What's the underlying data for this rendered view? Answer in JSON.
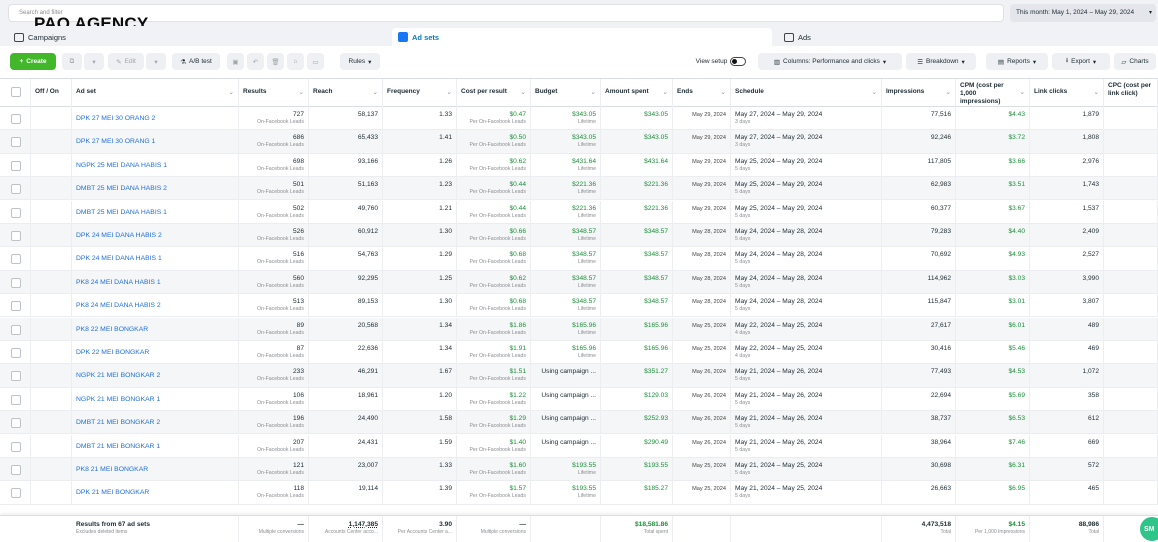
{
  "brand": "PAQ AGENCY",
  "search": {
    "placeholder": "Search and filter"
  },
  "date_range": "This month: May 1, 2024 – May 29, 2024",
  "tabs": {
    "campaigns": "Campaigns",
    "adsets": "Ad sets",
    "ads": "Ads"
  },
  "toolbar": {
    "create": "Create",
    "edit": "Edit",
    "ab_test": "A/B test",
    "rules": "Rules",
    "view_setup": "View setup",
    "columns": "Columns: Performance and clicks",
    "breakdown": "Breakdown",
    "reports": "Reports",
    "export": "Export",
    "charts": "Charts"
  },
  "columns": {
    "onoff": "Off / On",
    "adset": "Ad set",
    "results": "Results",
    "reach": "Reach",
    "frequency": "Frequency",
    "cpr": "Cost per result",
    "budget": "Budget",
    "spent": "Amount spent",
    "ends": "Ends",
    "schedule": "Schedule",
    "impressions": "Impressions",
    "cpm": "CPM (cost per 1,000 impressions)",
    "clicks": "Link clicks",
    "cpc": "CPC (cost per link click)"
  },
  "labels": {
    "results_sub": "On-Facebook Leads",
    "cpr_sub": "Per On-Facebook Leads",
    "budget_sub": "Lifetime"
  },
  "rows": [
    {
      "name": "DPK 27 MEI 30 ORANG 2",
      "results": "727",
      "reach": "58,137",
      "frequency": "1.33",
      "cpr": "$0.47",
      "budget": "$343.05",
      "spent": "$343.05",
      "ends": "May 29, 2024",
      "schedule": "May 27, 2024 – May 29, 2024",
      "days": "3 days",
      "impressions": "77,516",
      "cpm": "$4.43",
      "clicks": "1,879"
    },
    {
      "name": "DPK 27 MEI 30 ORANG 1",
      "results": "686",
      "reach": "65,433",
      "frequency": "1.41",
      "cpr": "$0.50",
      "budget": "$343.05",
      "spent": "$343.05",
      "ends": "May 29, 2024",
      "schedule": "May 27, 2024 – May 29, 2024",
      "days": "3 days",
      "impressions": "92,246",
      "cpm": "$3.72",
      "clicks": "1,808"
    },
    {
      "name": "NGPK 25 MEI DANA HABIS 1",
      "results": "698",
      "reach": "93,166",
      "frequency": "1.26",
      "cpr": "$0.62",
      "budget": "$431.64",
      "spent": "$431.64",
      "ends": "May 29, 2024",
      "schedule": "May 25, 2024 – May 29, 2024",
      "days": "5 days",
      "impressions": "117,805",
      "cpm": "$3.66",
      "clicks": "2,976"
    },
    {
      "name": "DMBT 25 MEI DANA HABIS 2",
      "results": "501",
      "reach": "51,163",
      "frequency": "1.23",
      "cpr": "$0.44",
      "budget": "$221.36",
      "spent": "$221.36",
      "ends": "May 29, 2024",
      "schedule": "May 25, 2024 – May 29, 2024",
      "days": "5 days",
      "impressions": "62,983",
      "cpm": "$3.51",
      "clicks": "1,743"
    },
    {
      "name": "DMBT 25 MEI DANA HABIS 1",
      "results": "502",
      "reach": "49,760",
      "frequency": "1.21",
      "cpr": "$0.44",
      "budget": "$221.36",
      "spent": "$221.36",
      "ends": "May 29, 2024",
      "schedule": "May 25, 2024 – May 29, 2024",
      "days": "5 days",
      "impressions": "60,377",
      "cpm": "$3.67",
      "clicks": "1,537"
    },
    {
      "name": "DPK 24 MEI DANA HABIS 2",
      "results": "526",
      "reach": "60,912",
      "frequency": "1.30",
      "cpr": "$0.66",
      "budget": "$348.57",
      "spent": "$348.57",
      "ends": "May 28, 2024",
      "schedule": "May 24, 2024 – May 28, 2024",
      "days": "5 days",
      "impressions": "79,283",
      "cpm": "$4.40",
      "clicks": "2,409"
    },
    {
      "name": "DPK 24 MEI DANA HABIS 1",
      "results": "516",
      "reach": "54,763",
      "frequency": "1.29",
      "cpr": "$0.68",
      "budget": "$348.57",
      "spent": "$348.57",
      "ends": "May 28, 2024",
      "schedule": "May 24, 2024 – May 28, 2024",
      "days": "5 days",
      "impressions": "70,692",
      "cpm": "$4.93",
      "clicks": "2,527"
    },
    {
      "name": "PK8 24 MEI DANA HABIS 1",
      "results": "560",
      "reach": "92,295",
      "frequency": "1.25",
      "cpr": "$0.62",
      "budget": "$348.57",
      "spent": "$348.57",
      "ends": "May 28, 2024",
      "schedule": "May 24, 2024 – May 28, 2024",
      "days": "5 days",
      "impressions": "114,962",
      "cpm": "$3.03",
      "clicks": "3,990"
    },
    {
      "name": "PK8 24 MEI DANA HABIS 2",
      "results": "513",
      "reach": "89,153",
      "frequency": "1.30",
      "cpr": "$0.68",
      "budget": "$348.57",
      "spent": "$348.57",
      "ends": "May 28, 2024",
      "schedule": "May 24, 2024 – May 28, 2024",
      "days": "5 days",
      "impressions": "115,847",
      "cpm": "$3.01",
      "clicks": "3,807"
    },
    {
      "name": "PK8 22 MEI BONGKAR",
      "results": "89",
      "reach": "20,568",
      "frequency": "1.34",
      "cpr": "$1.86",
      "budget": "$165.96",
      "spent": "$165.96",
      "ends": "May 25, 2024",
      "schedule": "May 22, 2024 – May 25, 2024",
      "days": "4 days",
      "impressions": "27,617",
      "cpm": "$6.01",
      "clicks": "489"
    },
    {
      "name": "DPK 22 MEI BONGKAR",
      "results": "87",
      "reach": "22,636",
      "frequency": "1.34",
      "cpr": "$1.91",
      "budget": "$165.96",
      "spent": "$165.96",
      "ends": "May 25, 2024",
      "schedule": "May 22, 2024 – May 25, 2024",
      "days": "4 days",
      "impressions": "30,416",
      "cpm": "$5.46",
      "clicks": "469"
    },
    {
      "name": "NGPK 21 MEI BONGKAR 2",
      "results": "233",
      "reach": "46,291",
      "frequency": "1.67",
      "cpr": "$1.51",
      "budget": "Using campaign ...",
      "spent": "$351.27",
      "ends": "May 26, 2024",
      "schedule": "May 21, 2024 – May 26, 2024",
      "days": "5 days",
      "impressions": "77,493",
      "cpm": "$4.53",
      "clicks": "1,072"
    },
    {
      "name": "NGPK 21 MEI BONGKAR 1",
      "results": "106",
      "reach": "18,961",
      "frequency": "1.20",
      "cpr": "$1.22",
      "budget": "Using campaign ...",
      "spent": "$129.03",
      "ends": "May 26, 2024",
      "schedule": "May 21, 2024 – May 26, 2024",
      "days": "5 days",
      "impressions": "22,694",
      "cpm": "$5.69",
      "clicks": "358"
    },
    {
      "name": "DMBT 21 MEI BONGKAR 2",
      "results": "196",
      "reach": "24,490",
      "frequency": "1.58",
      "cpr": "$1.29",
      "budget": "Using campaign ...",
      "spent": "$252.93",
      "ends": "May 26, 2024",
      "schedule": "May 21, 2024 – May 26, 2024",
      "days": "5 days",
      "impressions": "38,737",
      "cpm": "$6.53",
      "clicks": "612"
    },
    {
      "name": "DMBT 21 MEI BONGKAR 1",
      "results": "207",
      "reach": "24,431",
      "frequency": "1.59",
      "cpr": "$1.40",
      "budget": "Using campaign ...",
      "spent": "$290.49",
      "ends": "May 26, 2024",
      "schedule": "May 21, 2024 – May 26, 2024",
      "days": "5 days",
      "impressions": "38,964",
      "cpm": "$7.46",
      "clicks": "669"
    },
    {
      "name": "PK8 21 MEI BONGKAR",
      "results": "121",
      "reach": "23,007",
      "frequency": "1.33",
      "cpr": "$1.60",
      "budget": "$193.55",
      "spent": "$193.55",
      "ends": "May 25, 2024",
      "schedule": "May 21, 2024 – May 25, 2024",
      "days": "5 days",
      "impressions": "30,698",
      "cpm": "$6.31",
      "clicks": "572"
    },
    {
      "name": "DPK 21 MEI BONGKAR",
      "results": "118",
      "reach": "19,114",
      "frequency": "1.39",
      "cpr": "$1.57",
      "budget": "$193.55",
      "spent": "$185.27",
      "ends": "May 25, 2024",
      "schedule": "May 21, 2024 – May 25, 2024",
      "days": "5 days",
      "impressions": "26,663",
      "cpm": "$6.95",
      "clicks": "465"
    }
  ],
  "footer": {
    "title": "Results from 67 ad sets",
    "title_sub": "Excludes deleted items",
    "results": "—",
    "results_sub": "Multiple conversions",
    "reach": "1,147,385",
    "reach_sub": "Accounts Center acco...",
    "frequency": "3.90",
    "frequency_sub": "Per Accounts Center a...",
    "cpr": "—",
    "cpr_sub": "Multiple conversions",
    "spent": "$18,581.86",
    "spent_sub": "Total spent",
    "impressions": "4,473,518",
    "impressions_sub": "Total",
    "cpm": "$4.15",
    "cpm_sub": "Per 1,000 Impressions",
    "clicks": "88,986",
    "clicks_sub": "Total"
  },
  "badge": "SM"
}
